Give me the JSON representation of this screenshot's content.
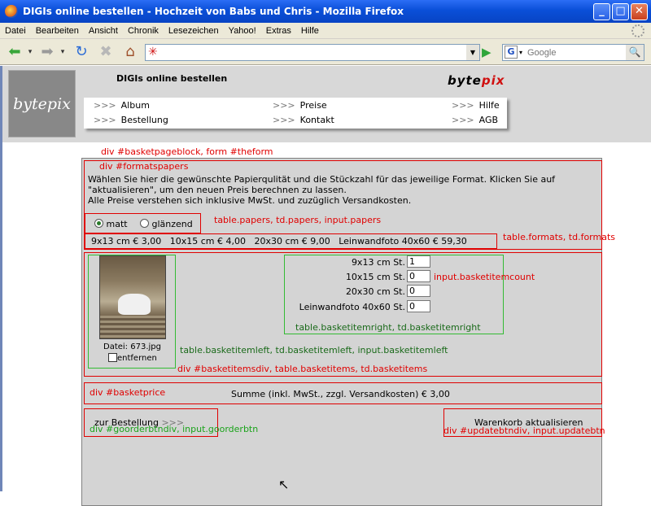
{
  "window": {
    "title": "DIGIs online bestellen - Hochzeit von Babs und Chris - Mozilla Firefox",
    "minimize": "_",
    "maximize": "□",
    "close": "✕"
  },
  "menu": [
    "Datei",
    "Bearbeiten",
    "Ansicht",
    "Chronik",
    "Lesezeichen",
    "Yahoo!",
    "Extras",
    "Hilfe"
  ],
  "toolbar": {
    "url": "",
    "search_placeholder": "Google",
    "search_engine_letter": "G"
  },
  "site": {
    "logo_text": "bytepix",
    "title": "DIGIs online bestellen",
    "brand_a": "byte",
    "brand_b": "pix",
    "nav": {
      "album": "Album",
      "bestellung": "Bestellung",
      "preise": "Preise",
      "kontakt": "Kontakt",
      "hilfe": "Hilfe",
      "agb": "AGB",
      "arrow": ">>>"
    }
  },
  "annotations": {
    "basketpageblock": "div #basketpageblock, form #theform",
    "formatspapers": "div #formatspapers",
    "papers": "table.papers, td.papers, input.papers",
    "formats": "table.formats, td.formats",
    "basketitemcount": "input.basketitemcount",
    "basketitemright": "table.basketitemright, td.basketitemright",
    "basketitemleft": "table.basketitemleft, td.basketitemleft, input.basketitemleft",
    "basketitemsdiv": "div #basketitemsdiv, table.basketitems, td.basketitems",
    "basketprice": "div #basketprice",
    "goorderbtndiv": "div #goorderbtndiv, input.goorderbtn",
    "updatebtndiv": "div #updatebtndiv, input.updatebtn"
  },
  "basket": {
    "intro_line1": "Wählen Sie hier die gewünschte Papierqulität und die Stückzahl für das jeweilige Format. Klicken Sie auf",
    "intro_line2": "\"aktualisieren\", um den neuen Preis berechnen zu lassen.",
    "intro_line3": "Alle Preise verstehen sich inklusive MwSt. und zuzüglich Versandkosten.",
    "paper_matt": "matt",
    "paper_glaenzend": "glänzend",
    "paper_selected": "matt",
    "formats_line": "9x13 cm € 3,00   10x15 cm € 4,00   20x30 cm € 9,00   Leinwandfoto 40x60 € 59,30",
    "item": {
      "filename": "Datei: 673.jpg",
      "remove_label": "entfernen",
      "rows": [
        {
          "label": "9x13 cm St.",
          "qty": "1"
        },
        {
          "label": "10x15 cm St.",
          "qty": "0"
        },
        {
          "label": "20x30 cm St.",
          "qty": "0"
        },
        {
          "label": "Leinwandfoto 40x60 St.",
          "qty": "0"
        }
      ]
    },
    "price": "Summe (inkl. MwSt., zzgl. Versandkosten) € 3,00",
    "order_button": "zur Bestellung",
    "order_arrows": ">>>",
    "update_button": "Warenkorb aktualisieren"
  }
}
